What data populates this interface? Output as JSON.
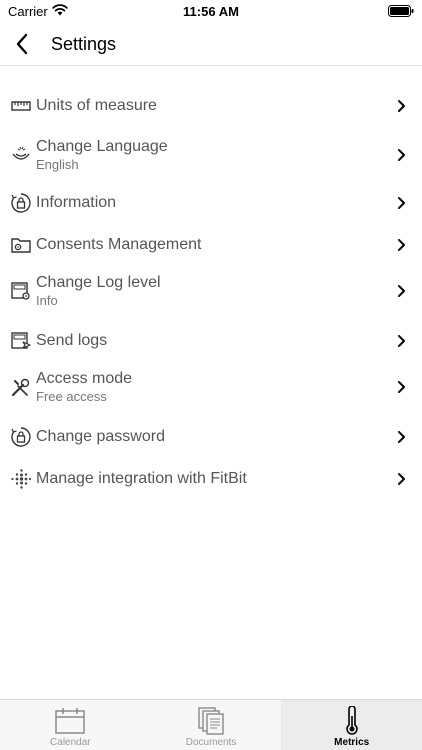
{
  "status_bar": {
    "carrier": "Carrier",
    "time": "11:56 AM"
  },
  "nav": {
    "title": "Settings"
  },
  "settings": [
    {
      "label": "Units of measure",
      "subtitle": "",
      "icon": "ruler-icon"
    },
    {
      "label": "Change Language",
      "subtitle": "English",
      "icon": "language-icon"
    },
    {
      "label": "Information",
      "subtitle": "",
      "icon": "info-lock-icon"
    },
    {
      "label": "Consents Management",
      "subtitle": "",
      "icon": "consents-folder-icon"
    },
    {
      "label": "Change Log level",
      "subtitle": "Info",
      "icon": "log-level-icon"
    },
    {
      "label": "Send logs",
      "subtitle": "",
      "icon": "send-logs-icon"
    },
    {
      "label": "Access mode",
      "subtitle": "Free access",
      "icon": "tools-icon"
    },
    {
      "label": "Change password",
      "subtitle": "",
      "icon": "password-lock-icon"
    },
    {
      "label": "Manage integration with FitBit",
      "subtitle": "",
      "icon": "fitbit-icon"
    }
  ],
  "tabs": [
    {
      "label": "Calendar",
      "icon": "calendar-icon",
      "active": false
    },
    {
      "label": "Documents",
      "icon": "documents-icon",
      "active": false
    },
    {
      "label": "Metrics",
      "icon": "thermometer-icon",
      "active": true
    }
  ]
}
